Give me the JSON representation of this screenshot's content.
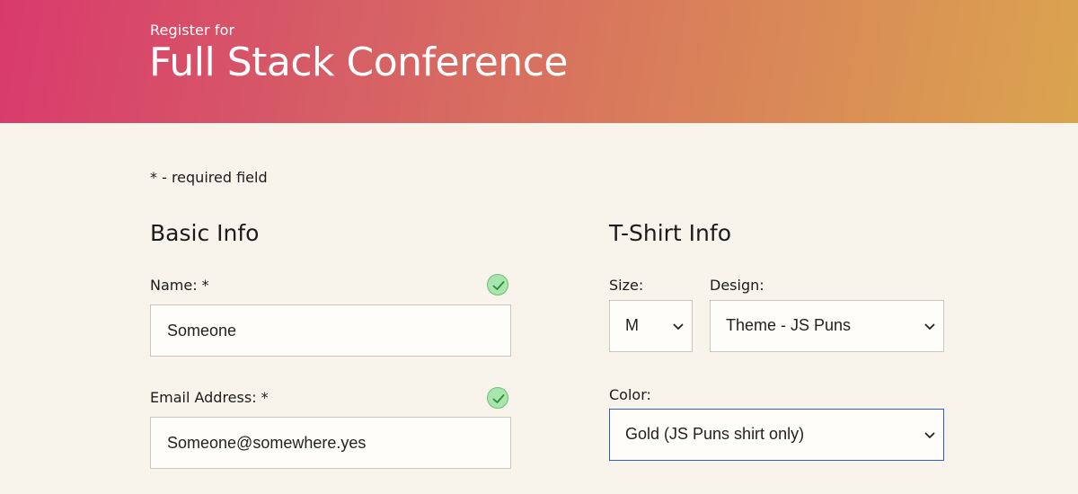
{
  "header": {
    "subtitle": "Register for",
    "title": "Full Stack Conference"
  },
  "required_note": "* - required field",
  "basic_info": {
    "title": "Basic Info",
    "name": {
      "label": "Name: *",
      "value": "Someone",
      "valid_icon": "check-circle-icon"
    },
    "email": {
      "label": "Email Address: *",
      "value": "Someone@somewhere.yes",
      "valid_icon": "check-circle-icon"
    }
  },
  "tshirt_info": {
    "title": "T-Shirt Info",
    "size": {
      "label": "Size:",
      "selected": "M"
    },
    "design": {
      "label": "Design:",
      "selected": "Theme - JS Puns"
    },
    "color": {
      "label": "Color:",
      "selected": "Gold (JS Puns shirt only)"
    }
  },
  "colors": {
    "header_gradient": [
      "#d93a6c",
      "#daa44f"
    ],
    "page_background": "#f8f4ec",
    "valid_check": "#a8e6ae",
    "focus_border": "#2b5ec9"
  }
}
